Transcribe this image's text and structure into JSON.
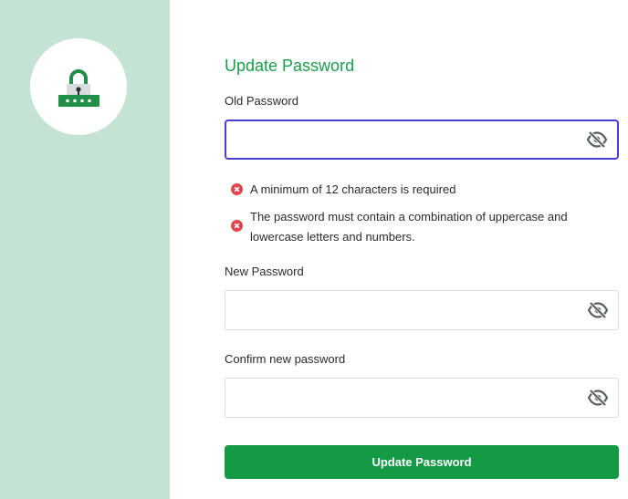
{
  "sidebar": {
    "background": "#c5e3d3",
    "logo_icon": "lock-password-icon"
  },
  "form": {
    "title": "Update Password",
    "old_password": {
      "label": "Old Password",
      "value": "",
      "placeholder": "",
      "icon": "eye-off-icon"
    },
    "rules": [
      {
        "icon": "error-icon",
        "text": "A minimum of 12 characters is required"
      },
      {
        "icon": "error-icon",
        "text_line1": "The password must contain a combination of uppercase and",
        "text_line2": "lowercase letters and numbers."
      }
    ],
    "new_password": {
      "label": "New Password",
      "value": "",
      "placeholder": "",
      "icon": "eye-off-icon"
    },
    "confirm_password": {
      "label": "Confirm new password",
      "value": "",
      "placeholder": "",
      "icon": "eye-off-icon"
    },
    "submit_label": "Update Password"
  },
  "colors": {
    "accent": "#1a9e4b",
    "button": "#149a44",
    "focus_border": "#4a3fd3",
    "error": "#e0474c"
  }
}
